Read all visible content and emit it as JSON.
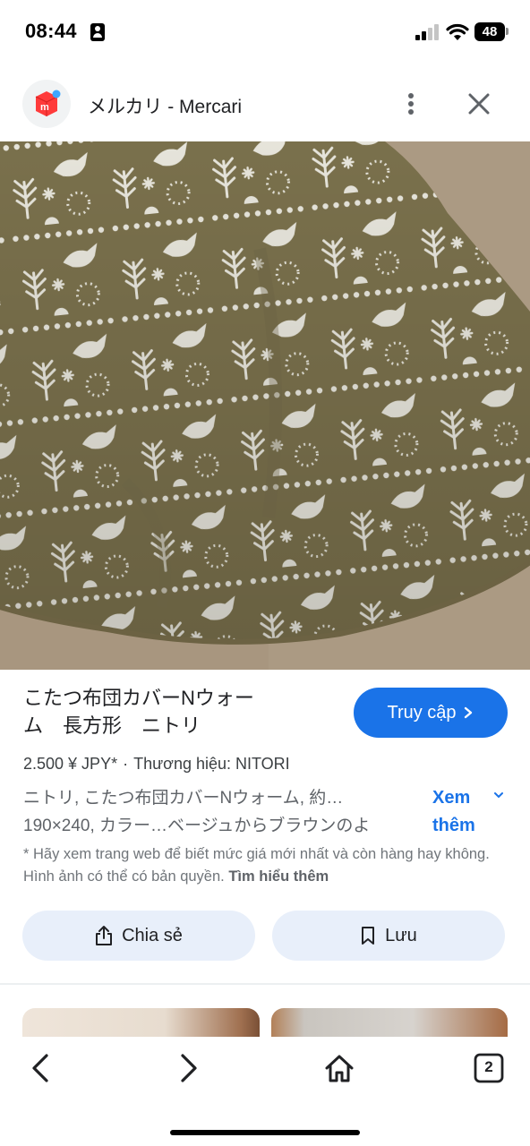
{
  "status_bar": {
    "time": "08:44",
    "battery": "48"
  },
  "header": {
    "site_title": "メルカリ - Mercari",
    "site_icon": "mercari-logo-icon",
    "more_icon": "more-vert-icon",
    "close_icon": "close-icon"
  },
  "product": {
    "title_line1": "こたつ布団カバーNウォー",
    "title_line2": "ム　長方形　ニトリ",
    "visit_button": "Truy cập",
    "price": "2.500 ¥ JPY*",
    "brand": "Thương hiệu: NITORI",
    "description_line1": "ニトリ, こたつ布団カバーNウォーム, 約…",
    "description_line2": "190×240, カラー…ベージュからブラウンのよ",
    "see_more": "Xem thêm",
    "disclaimer": "* Hãy xem trang web để biết mức giá mới nhất và còn hàng hay không. Hình ảnh có thể có bản quyền.",
    "learn_more": "Tìm hiểu thêm"
  },
  "actions": {
    "share_label": "Chia sẻ",
    "save_label": "Lưu"
  },
  "bottom_nav": {
    "tab_count": "2",
    "icons": [
      "back-icon",
      "forward-icon",
      "home-icon",
      "tabs-icon"
    ]
  },
  "colors": {
    "accent": "#1a73e8",
    "button_bg": "#e8effa",
    "blanket": "#807650",
    "floor": "#a8967f"
  }
}
